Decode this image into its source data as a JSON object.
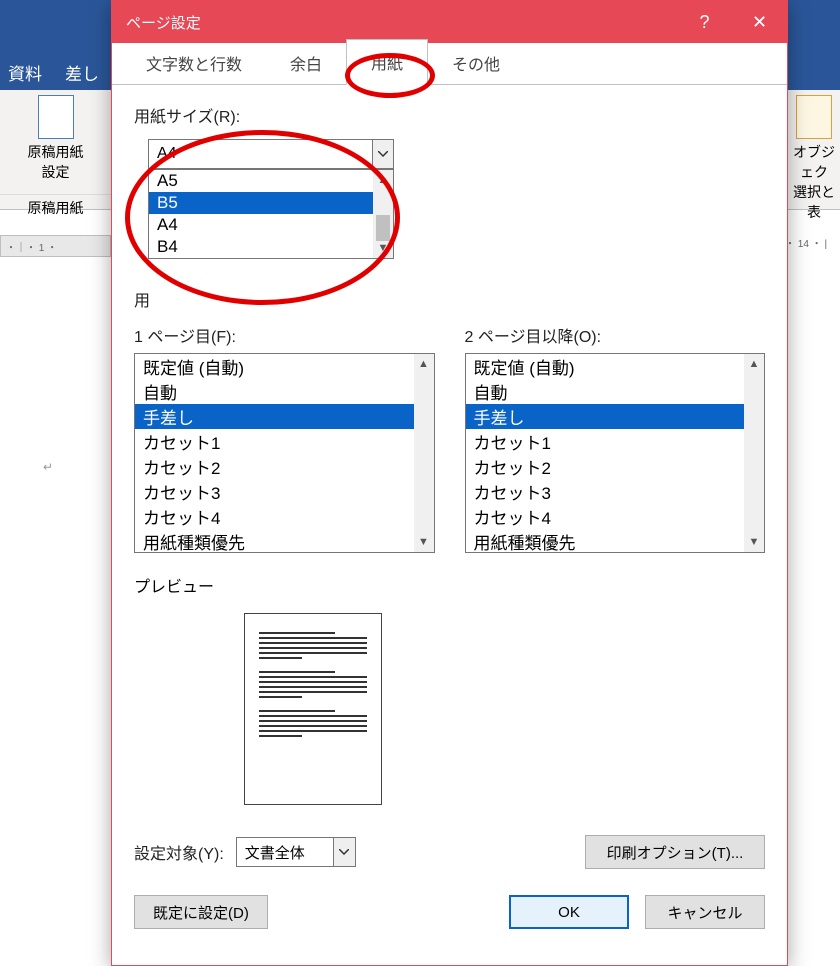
{
  "bg": {
    "ribbon_item1": "資料",
    "ribbon_item2": "差し",
    "panel_label1": "原稿用紙",
    "panel_label2": "設定",
    "panel_group": "原稿用紙",
    "right_label1": "オブジェク",
    "right_label2": "選択と表",
    "ruler_right": "・ 14 ・ |"
  },
  "dialog": {
    "title": "ページ設定",
    "help": "?",
    "close": "✕"
  },
  "tabs": [
    "文字数と行数",
    "余白",
    "用紙",
    "その他"
  ],
  "paper_size": {
    "label": "用紙サイズ(R):",
    "value": "A4",
    "options": [
      "A5",
      "B5",
      "A4",
      "B4"
    ]
  },
  "paper_tray_label": "用",
  "tray1": {
    "label": "1 ページ目(F):",
    "items": [
      "既定値 (自動)",
      "自動",
      "手差し",
      "カセット1",
      "カセット2",
      "カセット3",
      "カセット4",
      "用紙種類優先"
    ]
  },
  "tray2": {
    "label": "2 ページ目以降(O):",
    "items": [
      "既定値 (自動)",
      "自動",
      "手差し",
      "カセット1",
      "カセット2",
      "カセット3",
      "カセット4",
      "用紙種類優先"
    ]
  },
  "preview_label": "プレビュー",
  "apply_to": {
    "label": "設定対象(Y):",
    "value": "文書全体"
  },
  "print_options": "印刷オプション(T)...",
  "set_default": "既定に設定(D)",
  "ok": "OK",
  "cancel": "キャンセル"
}
